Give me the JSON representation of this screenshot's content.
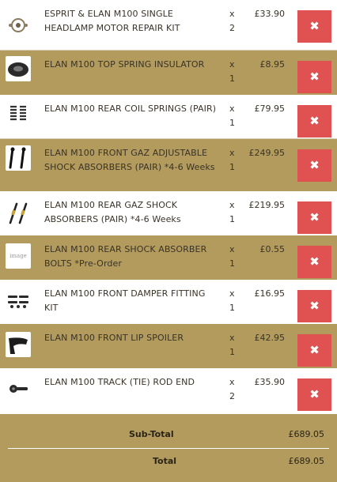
{
  "cart": {
    "items": [
      {
        "name": "ESPRIT & ELAN M100 SINGLE HEADLAMP MOTOR REPAIR KIT",
        "x": "x",
        "qty": "2",
        "price": "£33.90",
        "remove_label": "✖",
        "icon": "headlamp-motor-kit-icon"
      },
      {
        "name": "ELAN M100 TOP SPRING INSULATOR",
        "x": "x",
        "qty": "1",
        "price": "£8.95",
        "remove_label": "✖",
        "icon": "spring-insulator-icon"
      },
      {
        "name": "ELAN M100 REAR COIL SPRINGS (PAIR)",
        "x": "x",
        "qty": "1",
        "price": "£79.95",
        "remove_label": "✖",
        "icon": "coil-springs-icon"
      },
      {
        "name": "ELAN M100 FRONT GAZ ADJUSTABLE SHOCK ABSORBERS (PAIR) *4-6 Weeks",
        "x": "x",
        "qty": "1",
        "price": "£249.95",
        "remove_label": "✖",
        "icon": "shock-absorbers-icon"
      },
      {
        "name": "ELAN M100 REAR GAZ SHOCK ABSORBERS (PAIR) *4-6 Weeks",
        "x": "x",
        "qty": "1",
        "price": "£219.95",
        "remove_label": "✖",
        "icon": "rear-shock-absorbers-icon"
      },
      {
        "name": "ELAN M100 REAR SHOCK ABSORBER BOLTS *Pre-Order",
        "x": "x",
        "qty": "1",
        "price": "£0.55",
        "remove_label": "✖",
        "icon": "image-placeholder-icon",
        "thumb_text": "image"
      },
      {
        "name": "ELAN M100 FRONT DAMPER FITTING KIT",
        "x": "x",
        "qty": "1",
        "price": "£16.95",
        "remove_label": "✖",
        "icon": "damper-fitting-kit-icon"
      },
      {
        "name": "ELAN M100 FRONT LIP SPOILER",
        "x": "x",
        "qty": "1",
        "price": "£42.95",
        "remove_label": "✖",
        "icon": "lip-spoiler-icon"
      },
      {
        "name": "ELAN M100 TRACK (TIE) ROD END",
        "x": "x",
        "qty": "2",
        "price": "£35.90",
        "remove_label": "✖",
        "icon": "tie-rod-end-icon"
      }
    ]
  },
  "totals": {
    "subtotal_label": "Sub-Total",
    "subtotal_value": "£689.05",
    "total_label": "Total",
    "total_value": "£689.05"
  },
  "colors": {
    "gold": "#b29b5c",
    "white": "#ffffff",
    "remove": "#e05252"
  }
}
